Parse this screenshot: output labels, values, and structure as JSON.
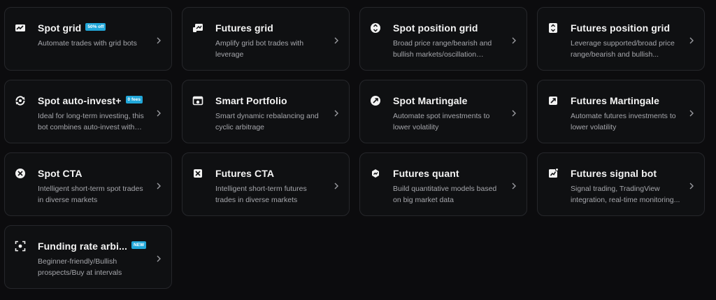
{
  "cards": [
    {
      "title": "Spot grid",
      "badge": "50% off",
      "desc": "Automate trades with grid bots",
      "icon": "spot-grid-icon"
    },
    {
      "title": "Futures grid",
      "badge": "",
      "desc": "Amplify grid bot trades with leverage",
      "icon": "futures-grid-icon"
    },
    {
      "title": "Spot position grid",
      "badge": "",
      "desc": "Broad price range/bearish and bullish markets/oscillation tolerance",
      "icon": "spot-position-grid-icon"
    },
    {
      "title": "Futures position grid",
      "badge": "",
      "desc": "Leverage supported/broad price range/bearish and bullish...",
      "icon": "futures-position-grid-icon"
    },
    {
      "title": "Spot auto-invest+",
      "badge": "0 fees",
      "desc": "Ideal for long-term investing, this bot combines auto-invest with Ear...",
      "icon": "auto-invest-icon"
    },
    {
      "title": "Smart Portfolio",
      "badge": "",
      "desc": "Smart dynamic rebalancing and cyclic arbitrage",
      "icon": "smart-portfolio-icon"
    },
    {
      "title": "Spot Martingale",
      "badge": "",
      "desc": "Automate spot investments to lower volatility",
      "icon": "spot-martingale-icon"
    },
    {
      "title": "Futures Martingale",
      "badge": "",
      "desc": "Automate futures investments to lower volatility",
      "icon": "futures-martingale-icon"
    },
    {
      "title": "Spot CTA",
      "badge": "",
      "desc": "Intelligent short-term spot trades in diverse markets",
      "icon": "spot-cta-icon"
    },
    {
      "title": "Futures CTA",
      "badge": "",
      "desc": "Intelligent short-term futures trades in diverse markets",
      "icon": "futures-cta-icon"
    },
    {
      "title": "Futures quant",
      "badge": "",
      "desc": "Build quantitative models based on big market data",
      "icon": "futures-quant-icon"
    },
    {
      "title": "Futures signal bot",
      "badge": "",
      "desc": "Signal trading, TradingView integration, real-time monitoring...",
      "icon": "signal-bot-icon"
    },
    {
      "title": "Funding rate arbi...",
      "badge": "NEW",
      "desc": "Beginner-friendly/Bullish prospects/Buy at intervals",
      "icon": "funding-rate-icon"
    }
  ],
  "colors": {
    "background": "#0c0c0e",
    "card": "#0f1012",
    "border": "#26272b",
    "badge": "#21a7d9"
  }
}
